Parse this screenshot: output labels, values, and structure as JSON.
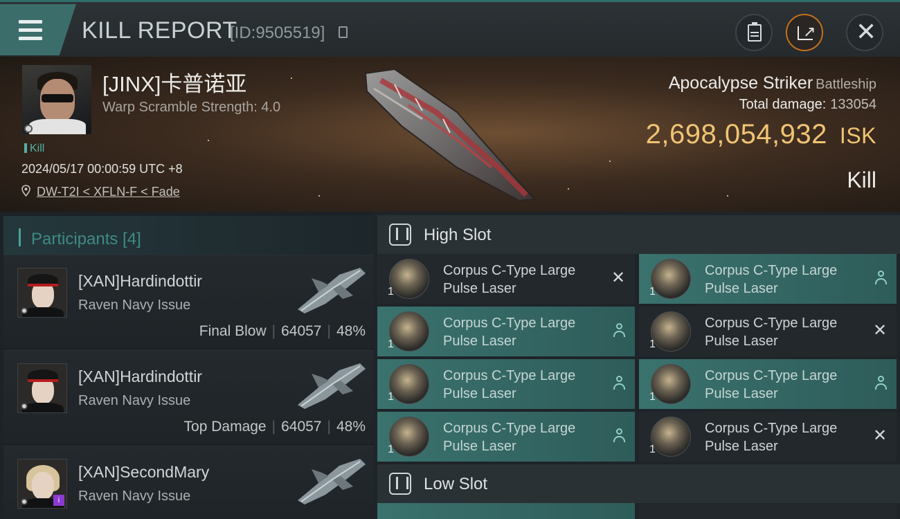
{
  "header": {
    "title": "KILL REPORT",
    "report_id": "[ID:9505519]"
  },
  "victim": {
    "name": "[JINX]卡普诺亚",
    "warp_scramble": "Warp Scramble Strength: 4.0",
    "tag": "Kill",
    "timestamp": "2024/05/17 00:00:59 UTC +8",
    "location": "DW-T2I < XFLN-F < Fade",
    "ship_name": "Apocalypse Striker",
    "ship_class": "Battleship",
    "total_damage_label": "Total damage:",
    "total_damage_value": "133054",
    "isk_value": "2,698,054,932",
    "isk_unit": "ISK",
    "result": "Kill"
  },
  "participants": {
    "title": "Participants [4]",
    "items": [
      {
        "name": "[XAN]Hardindottir",
        "ship": "Raven Navy Issue",
        "role": "Final Blow",
        "damage": "64057",
        "percent": "48%"
      },
      {
        "name": "[XAN]Hardindottir",
        "ship": "Raven Navy Issue",
        "role": "Top Damage",
        "damage": "64057",
        "percent": "48%"
      },
      {
        "name": "[XAN]SecondMary",
        "ship": "Raven Navy Issue"
      }
    ]
  },
  "fitting": {
    "high_slot_label": "High Slot",
    "low_slot_label": "Low Slot",
    "modules": [
      {
        "line1": "Corpus C-Type Large",
        "line2": "Pulse Laser",
        "qty": "1",
        "state": "destroyed"
      },
      {
        "line1": "Corpus C-Type Large",
        "line2": "Pulse Laser",
        "qty": "1",
        "state": "dropped"
      },
      {
        "line1": "Corpus C-Type Large",
        "line2": "Pulse Laser",
        "qty": "1",
        "state": "dropped"
      },
      {
        "line1": "Corpus C-Type Large",
        "line2": "Pulse Laser",
        "qty": "1",
        "state": "destroyed"
      },
      {
        "line1": "Corpus C-Type Large",
        "line2": "Pulse Laser",
        "qty": "1",
        "state": "dropped"
      },
      {
        "line1": "Corpus C-Type Large",
        "line2": "Pulse Laser",
        "qty": "1",
        "state": "dropped"
      },
      {
        "line1": "Corpus C-Type Large",
        "line2": "Pulse Laser",
        "qty": "1",
        "state": "dropped"
      },
      {
        "line1": "Corpus C-Type Large",
        "line2": "Pulse Laser",
        "qty": "1",
        "state": "destroyed"
      }
    ],
    "destroyed_glyph": "✕"
  },
  "colors": {
    "accent_teal": "#3b6e6b",
    "isk_gold": "#f0c474",
    "share_ring": "#c6701c"
  }
}
